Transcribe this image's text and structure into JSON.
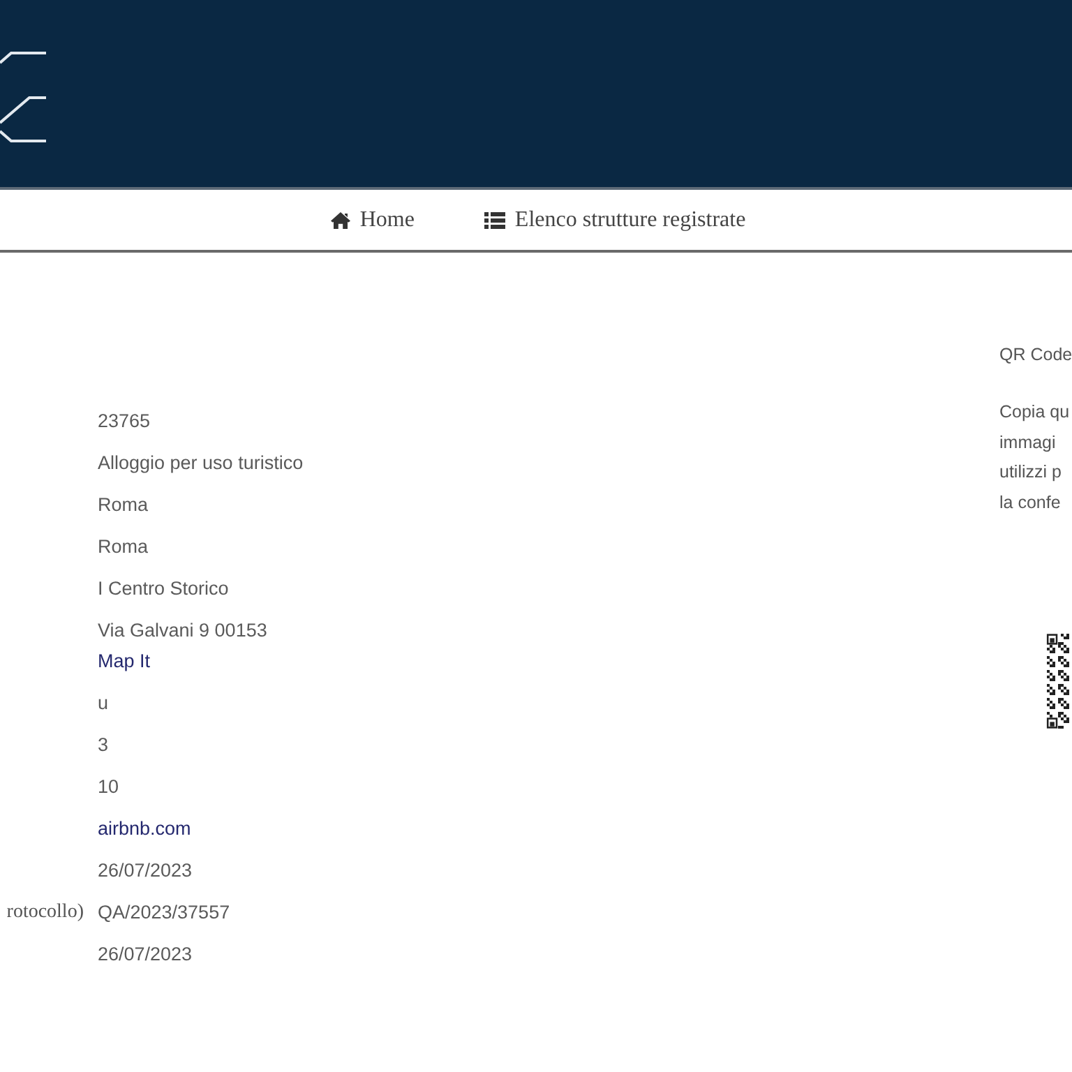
{
  "header": {
    "nav": [
      {
        "kind": "home",
        "label": "Home"
      },
      {
        "kind": "list",
        "label": "Elenco strutture registrate"
      }
    ]
  },
  "details": [
    {
      "kind": "text",
      "value": "23765"
    },
    {
      "kind": "text",
      "value": "Alloggio per uso turistico"
    },
    {
      "kind": "text",
      "value": "Roma"
    },
    {
      "kind": "text",
      "value": "Roma"
    },
    {
      "kind": "text",
      "value": "I Centro Storico"
    },
    {
      "kind": "address",
      "value": "Via Galvani 9 00153",
      "link": "Map It"
    },
    {
      "kind": "text",
      "value": "u"
    },
    {
      "kind": "text",
      "value": "3"
    },
    {
      "kind": "text",
      "value": "10"
    },
    {
      "kind": "link",
      "value": "airbnb.com"
    },
    {
      "kind": "text",
      "value": "26/07/2023"
    },
    {
      "kind": "text",
      "label": "rotocollo)",
      "value": "QA/2023/37557"
    },
    {
      "kind": "text",
      "value": "26/07/2023"
    }
  ],
  "qr_panel": {
    "title": "QR Code",
    "text_lines": [
      "Copia qu",
      "immagi",
      "utilizzi p",
      "la confe"
    ]
  }
}
